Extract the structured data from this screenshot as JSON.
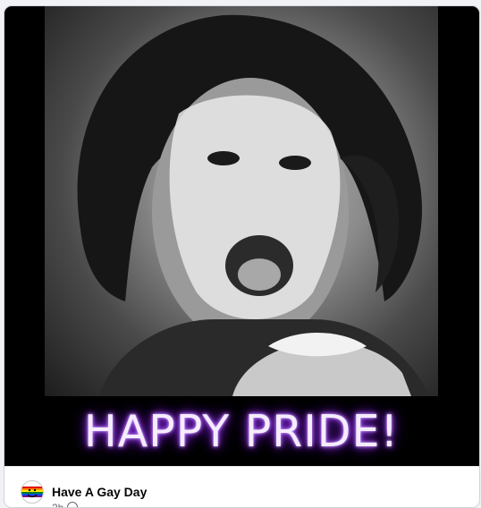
{
  "post": {
    "caption": "HAPPY PRIDE!",
    "author": "Have A Gay Day",
    "timestamp": "2h",
    "privacy_icon": "globe-icon",
    "avatar_icon": "rainbow-smiley-logo"
  },
  "colors": {
    "caption_text": "#f4ecff",
    "caption_glow": "#a44dff",
    "media_background": "#000000",
    "author_text": "#050505",
    "meta_text": "#65676b"
  }
}
